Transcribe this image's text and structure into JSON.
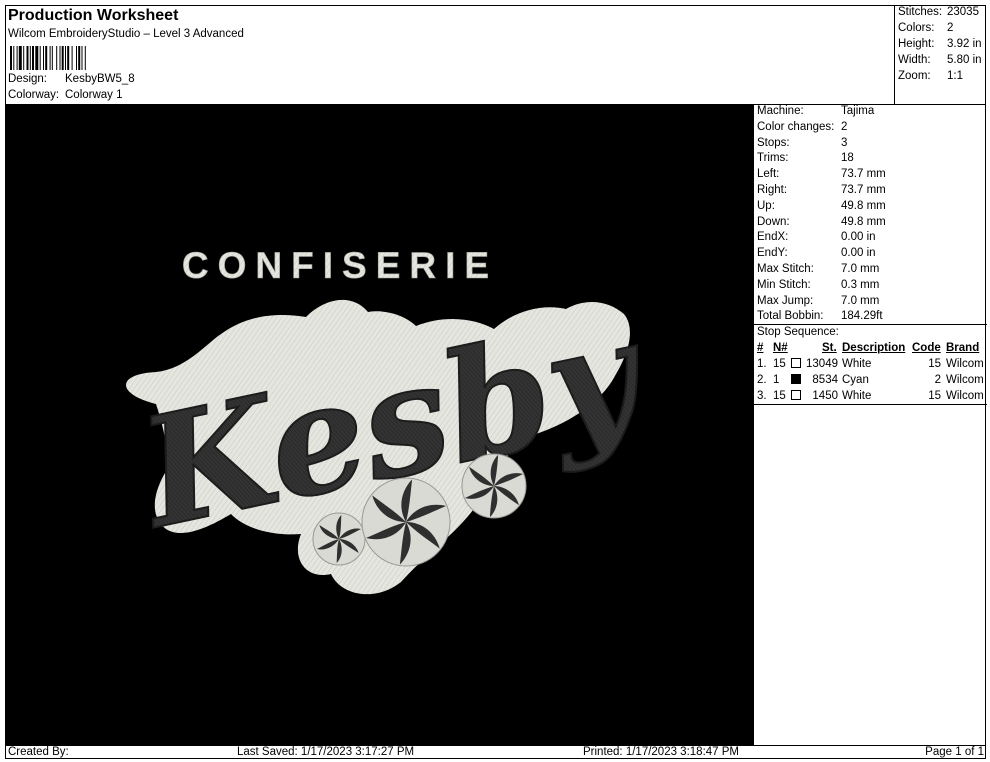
{
  "header": {
    "title": "Production Worksheet",
    "subtitle": "Wilcom EmbroideryStudio – Level 3 Advanced",
    "design_label": "Design:",
    "design_value": "KesbyBW5_8",
    "colorway_label": "Colorway:",
    "colorway_value": "Colorway 1"
  },
  "stats": [
    {
      "label": "Stitches:",
      "value": "23035"
    },
    {
      "label": "Colors:",
      "value": "2"
    },
    {
      "label": "Height:",
      "value": "3.92 in"
    },
    {
      "label": "Width:",
      "value": "5.80 in"
    },
    {
      "label": "Zoom:",
      "value": "1:1"
    }
  ],
  "design": {
    "top_text": "CONFISERIE",
    "main_text": "Kesby",
    "background": "#000000",
    "thread_light": "#e4e6df",
    "thread_dark": "#333333"
  },
  "properties": [
    {
      "label": "Machine:",
      "value": "Tajima"
    },
    {
      "label": "Color changes:",
      "value": "2"
    },
    {
      "label": "Stops:",
      "value": "3"
    },
    {
      "label": "Trims:",
      "value": "18"
    },
    {
      "label": "Left:",
      "value": "73.7 mm"
    },
    {
      "label": "Right:",
      "value": "73.7 mm"
    },
    {
      "label": "Up:",
      "value": "49.8 mm"
    },
    {
      "label": "Down:",
      "value": "49.8 mm"
    },
    {
      "label": "EndX:",
      "value": "0.00 in"
    },
    {
      "label": "EndY:",
      "value": "0.00 in"
    },
    {
      "label": "Max Stitch:",
      "value": "7.0 mm"
    },
    {
      "label": "Min Stitch:",
      "value": "0.3 mm"
    },
    {
      "label": "Max Jump:",
      "value": "7.0 mm"
    },
    {
      "label": "Total Bobbin:",
      "value": "184.29ft"
    }
  ],
  "stop_sequence": {
    "title": "Stop Sequence:",
    "columns": {
      "num": "#",
      "n": "N#",
      "st": "St.",
      "desc": "Description",
      "code": "Code",
      "brand": "Brand"
    },
    "rows": [
      {
        "num": "1.",
        "n": "15",
        "swatch": "#ffffff",
        "st": "13049",
        "desc": "White",
        "code": "15",
        "brand": "Wilcom"
      },
      {
        "num": "2.",
        "n": "1",
        "swatch": "#000000",
        "st": "8534",
        "desc": "Cyan",
        "code": "2",
        "brand": "Wilcom"
      },
      {
        "num": "3.",
        "n": "15",
        "swatch": "#ffffff",
        "st": "1450",
        "desc": "White",
        "code": "15",
        "brand": "Wilcom"
      }
    ]
  },
  "footer": {
    "created": "Created By:",
    "saved": "Last Saved: 1/17/2023 3:17:27 PM",
    "printed": "Printed: 1/17/2023 3:18:47 PM",
    "page": "Page 1 of 1"
  }
}
